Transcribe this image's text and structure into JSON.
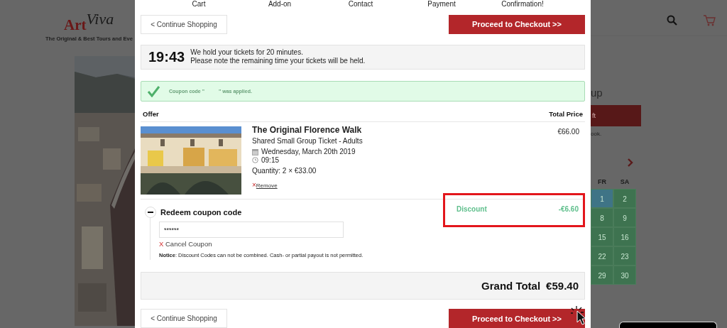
{
  "background_page": {
    "logo": {
      "word": "Art",
      "script": "Viva"
    },
    "tagline": "The Original & Best Tours and Eve",
    "side_heading": "up",
    "side_button": "ft",
    "side_text": "ook.",
    "calendar": {
      "weekdays": [
        "FR",
        "SA"
      ],
      "days": [
        {
          "label": "1",
          "color": "#3f7486"
        },
        {
          "label": "2",
          "color": "#3e7350"
        },
        {
          "label": "8",
          "color": "#3e7350"
        },
        {
          "label": "9",
          "color": "#3e7350"
        },
        {
          "label": "15",
          "color": "#3e7350"
        },
        {
          "label": "16",
          "color": "#3e7350"
        },
        {
          "label": "22",
          "color": "#3e7350"
        },
        {
          "label": "23",
          "color": "#3e7350"
        },
        {
          "label": "29",
          "color": "#3e7350"
        },
        {
          "label": "30",
          "color": "#3e7350"
        }
      ]
    }
  },
  "steps": [
    "Cart",
    "Add-on",
    "Contact",
    "Payment",
    "Confirmation!"
  ],
  "top_buttons": {
    "continue": "< Continue Shopping",
    "checkout": "Proceed to Checkout >>"
  },
  "timer": {
    "time": "19:43",
    "lines": [
      "We hold your tickets for 20 minutes.",
      "Please note the remaining time your tickets will be held."
    ]
  },
  "coupon_notice": {
    "prefix": "Coupon code \"",
    "suffix": "\" was applied."
  },
  "table": {
    "columns": [
      "Offer",
      "Total Price"
    ],
    "items": [
      {
        "title": "The Original Florence Walk",
        "ticket": "Shared Small Group Ticket - Adults",
        "date": "Wednesday, March 20th 2019",
        "time": "09:15",
        "quantity": "Quantity: 2 × €33.00",
        "remove_mark": "×",
        "remove": "Remove",
        "price": "€66.00"
      }
    ]
  },
  "coupon": {
    "title": "Redeem coupon code",
    "expanded": true,
    "value": "******",
    "cancel_mark": "X",
    "cancel": "Cancel Coupon",
    "notice": "**Notice**: Discount Codes can not be combined. Cash- or partial payout is not permitted."
  },
  "discount": {
    "label": "Discount",
    "amount": "-€6.60",
    "highlighted": true
  },
  "grand_total": {
    "label": "Grand Total",
    "amount": "€59.40"
  },
  "bottom_buttons": {
    "continue": "< Continue Shopping",
    "checkout": "Proceed to Checkout >>"
  }
}
